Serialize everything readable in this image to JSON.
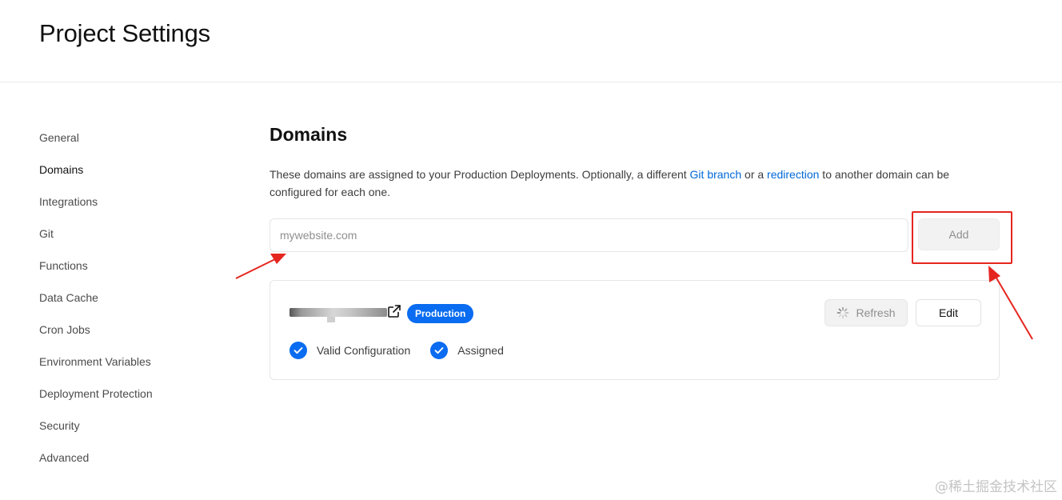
{
  "header": {
    "title": "Project Settings"
  },
  "sidebar": {
    "items": [
      {
        "label": "General"
      },
      {
        "label": "Domains"
      },
      {
        "label": "Integrations"
      },
      {
        "label": "Git"
      },
      {
        "label": "Functions"
      },
      {
        "label": "Data Cache"
      },
      {
        "label": "Cron Jobs"
      },
      {
        "label": "Environment Variables"
      },
      {
        "label": "Deployment Protection"
      },
      {
        "label": "Security"
      },
      {
        "label": "Advanced"
      }
    ],
    "active_item": "Domains"
  },
  "main": {
    "title": "Domains",
    "description": {
      "part1": "These domains are assigned to your Production Deployments. Optionally, a different ",
      "link1": "Git branch",
      "part2": " or a ",
      "link2": "redirection",
      "part3": " to another domain can be configured for each one."
    },
    "domain_input": {
      "value": "",
      "placeholder": "mywebsite.com"
    },
    "add_button_label": "Add",
    "domain_card": {
      "badge": "Production",
      "refresh_label": "Refresh",
      "edit_label": "Edit",
      "statuses": [
        {
          "label": "Valid Configuration"
        },
        {
          "label": "Assigned"
        }
      ]
    }
  },
  "colors": {
    "accent_blue": "#0a6cf0",
    "link_blue": "#0068d6",
    "annotation_red": "#e5261f"
  },
  "watermark": "@稀土掘金技术社区"
}
